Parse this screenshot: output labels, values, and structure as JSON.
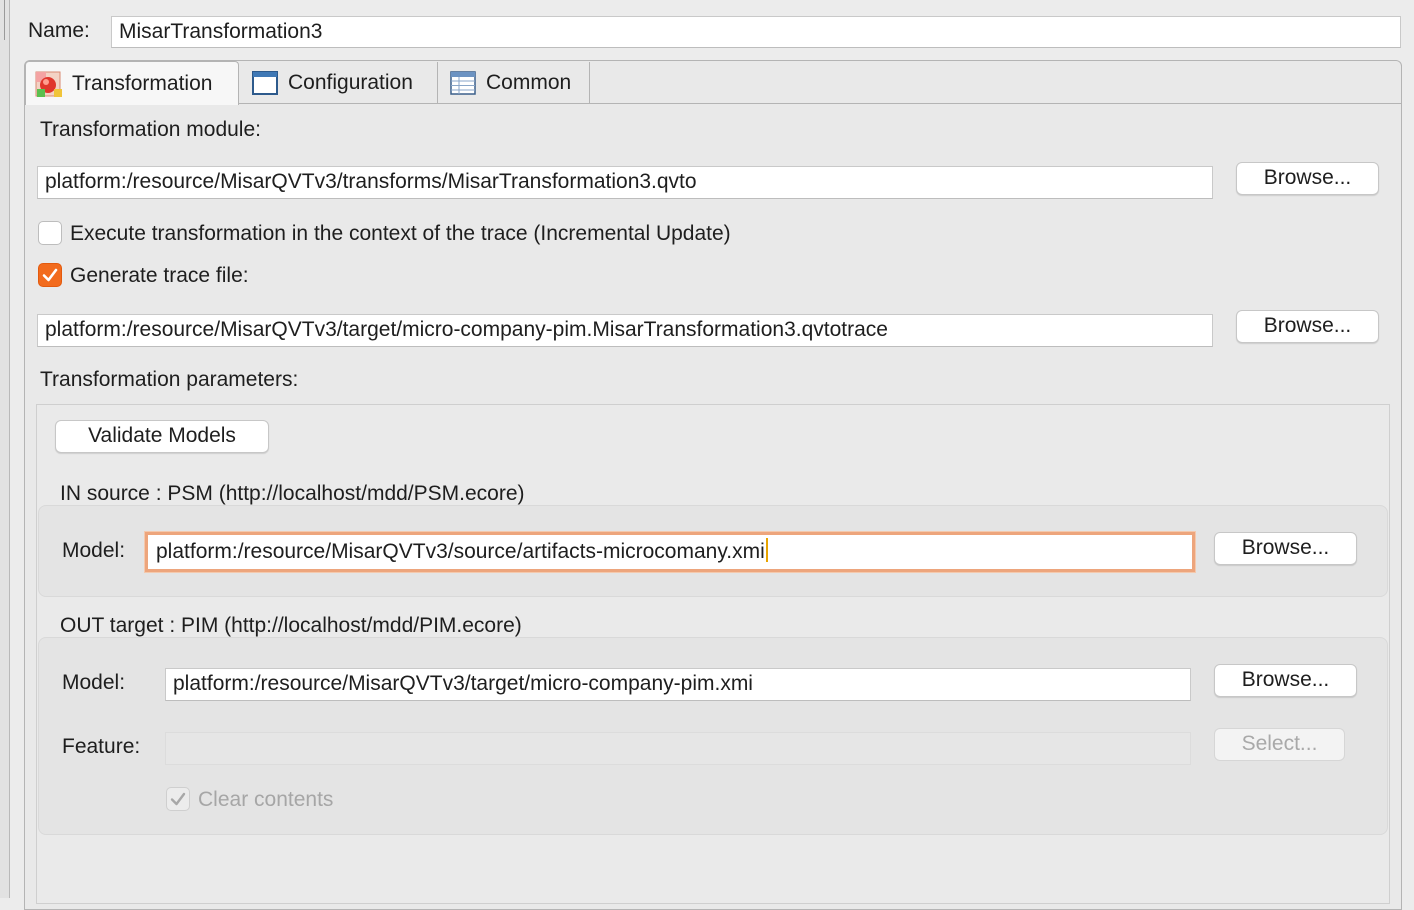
{
  "name": {
    "label": "Name:",
    "value": "MisarTransformation3"
  },
  "tabs": [
    {
      "label": "Transformation",
      "icon": "transformation-icon",
      "active": true
    },
    {
      "label": "Configuration",
      "icon": "window-icon",
      "active": false
    },
    {
      "label": "Common",
      "icon": "table-icon",
      "active": false
    }
  ],
  "module": {
    "label": "Transformation module:",
    "value": "platform:/resource/MisarQVTv3/transforms/MisarTransformation3.qvto",
    "browse": "Browse..."
  },
  "incremental": {
    "label": "Execute transformation in the context of the trace (Incremental Update)",
    "checked": false
  },
  "trace": {
    "label": "Generate trace file:",
    "checked": true,
    "value": "platform:/resource/MisarQVTv3/target/micro-company-pim.MisarTransformation3.qvtotrace",
    "browse": "Browse..."
  },
  "params": {
    "label": "Transformation parameters:",
    "validate": "Validate Models",
    "in": {
      "header": "IN  source : PSM (http://localhost/mdd/PSM.ecore)",
      "model_label": "Model:",
      "model_value": "platform:/resource/MisarQVTv3/source/artifacts-microcomany.xmi",
      "browse": "Browse..."
    },
    "out": {
      "header": "OUT  target : PIM (http://localhost/mdd/PIM.ecore)",
      "model_label": "Model:",
      "model_value": "platform:/resource/MisarQVTv3/target/micro-company-pim.xmi",
      "browse": "Browse...",
      "feature_label": "Feature:",
      "feature_value": "",
      "select": "Select...",
      "clear_label": "Clear contents",
      "clear_checked": true
    }
  },
  "colors": {
    "accent": "#f26b1d",
    "focus": "#eda57c"
  }
}
